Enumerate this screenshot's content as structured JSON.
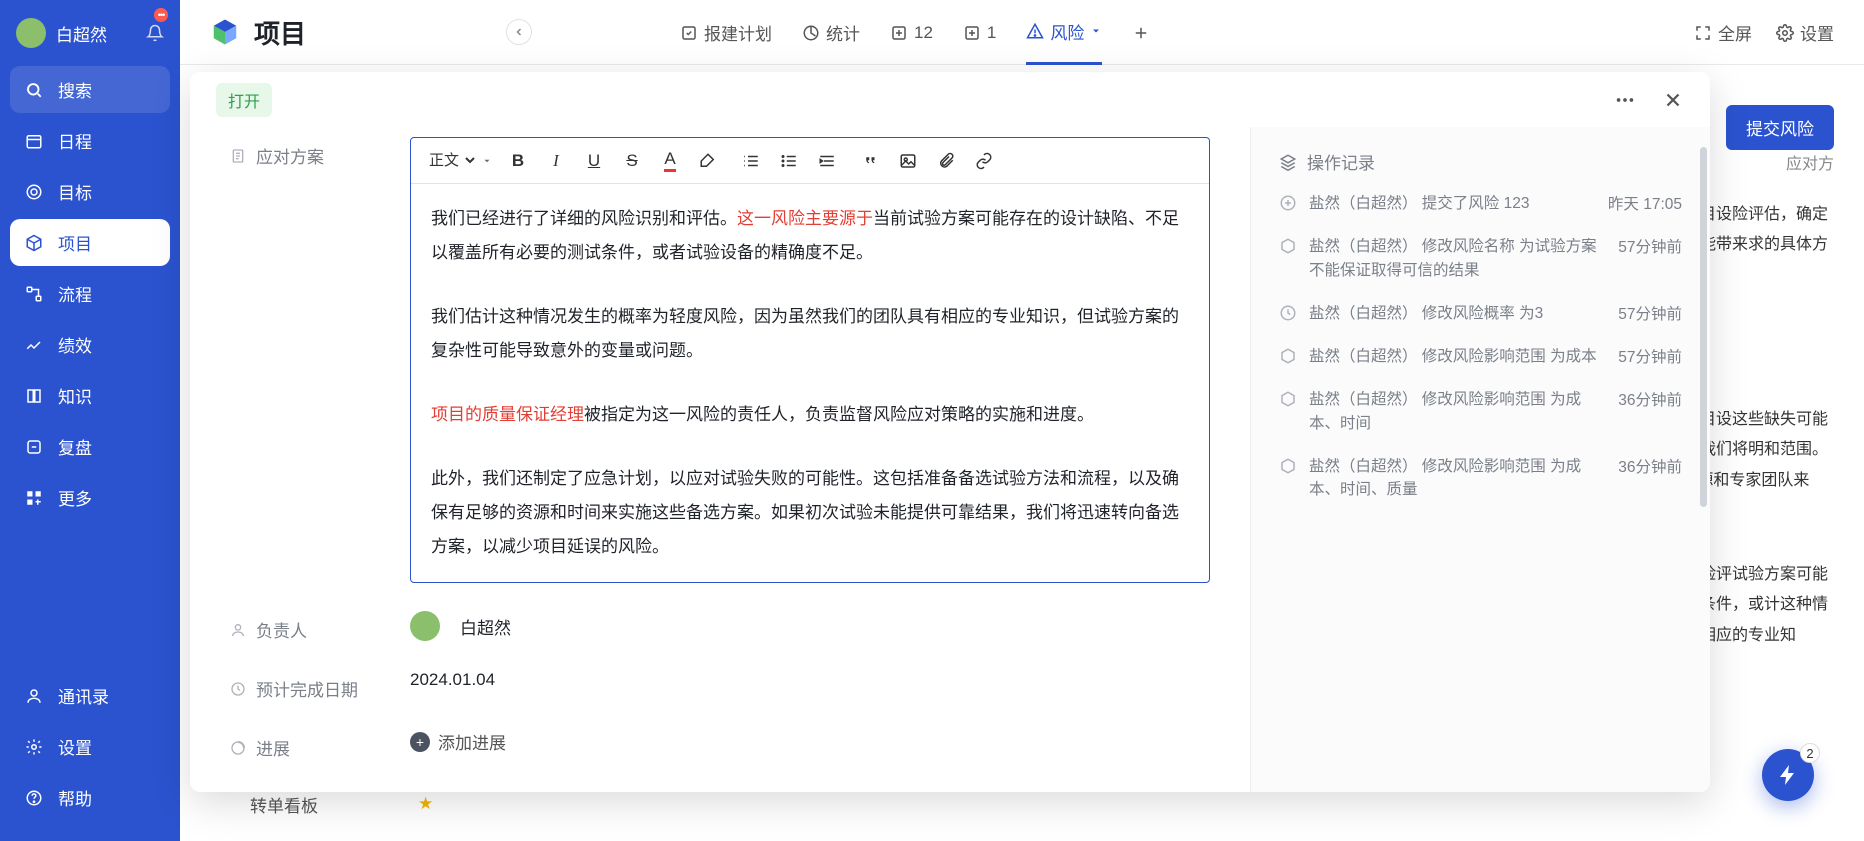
{
  "user": {
    "name": "白超然"
  },
  "sidebar": {
    "search": "搜索",
    "items": [
      {
        "label": "日程"
      },
      {
        "label": "目标"
      },
      {
        "label": "项目"
      },
      {
        "label": "流程"
      },
      {
        "label": "绩效"
      },
      {
        "label": "知识"
      },
      {
        "label": "复盘"
      },
      {
        "label": "更多"
      }
    ],
    "bottom": [
      {
        "label": "通讯录"
      },
      {
        "label": "设置"
      },
      {
        "label": "帮助"
      }
    ]
  },
  "main": {
    "title": "项目",
    "tabs": [
      {
        "label": "报建计划"
      },
      {
        "label": "统计"
      },
      {
        "label": "12"
      },
      {
        "label": "1"
      },
      {
        "label": "风险"
      }
    ],
    "header_right": {
      "fullscreen": "全屏",
      "settings": "设置"
    },
    "submit_risk": "提交风险",
    "behind_heading": "应对方",
    "behind_text1": "将通过审查项目设险评估，确定设这些缺失可能带来求的具体方面和",
    "behind_text2": "将通过审查项目设这些缺失可能带来业标准，我们将明和范围。[附件] 确的资源和专家团队来",
    "behind_text3": "行了详细的风险评试验方案可能存在要的测试条件，或计这种情况发生的具有相应的专业知",
    "behind_row": {
      "label": "转单看板"
    },
    "fab_badge": "2"
  },
  "modal": {
    "open": "打开",
    "fields": {
      "plan_label": "应对方案",
      "owner_label": "负责人",
      "owner_value": "白超然",
      "due_label": "预计完成日期",
      "due_value": "2024.01.04",
      "progress_label": "进展",
      "add_progress": "添加进展"
    },
    "toolbar": {
      "format": "正文"
    },
    "editor": {
      "p1a": "我们已经进行了详细的风险识别和评估。",
      "p1red": "这一风险主要源于",
      "p1b": "当前试验方案可能存在的设计缺陷、不足以覆盖所有必要的测试条件，或者试验设备的精确度不足。",
      "p2": "我们估计这种情况发生的概率为轻度风险，因为虽然我们的团队具有相应的专业知识，但试验方案的复杂性可能导致意外的变量或问题。",
      "p3red": "项目的质量保证经理",
      "p3": "被指定为这一风险的责任人，负责监督风险应对策略的实施和进度。",
      "p4": "此外，我们还制定了应急计划，以应对试验失败的可能性。这包括准备备选试验方法和流程，以及确保有足够的资源和时间来实施这些备选方案。如果初次试验未能提供可靠结果，我们将迅速转向备选方案，以减少项目延误的风险。"
    },
    "history": {
      "title": "操作记录",
      "items": [
        {
          "text": "盐然（白超然） 提交了风险 123",
          "time": "昨天 17:05"
        },
        {
          "text": "盐然（白超然） 修改风险名称 为试验方案不能保证取得可信的结果",
          "time": "57分钟前"
        },
        {
          "text": "盐然（白超然） 修改风险概率 为3",
          "time": "57分钟前"
        },
        {
          "text": "盐然（白超然） 修改风险影响范围 为成本",
          "time": "57分钟前"
        },
        {
          "text": "盐然（白超然） 修改风险影响范围 为成本、时间",
          "time": "36分钟前"
        },
        {
          "text": "盐然（白超然） 修改风险影响范围 为成本、时间、质量",
          "time": "36分钟前"
        }
      ]
    }
  }
}
